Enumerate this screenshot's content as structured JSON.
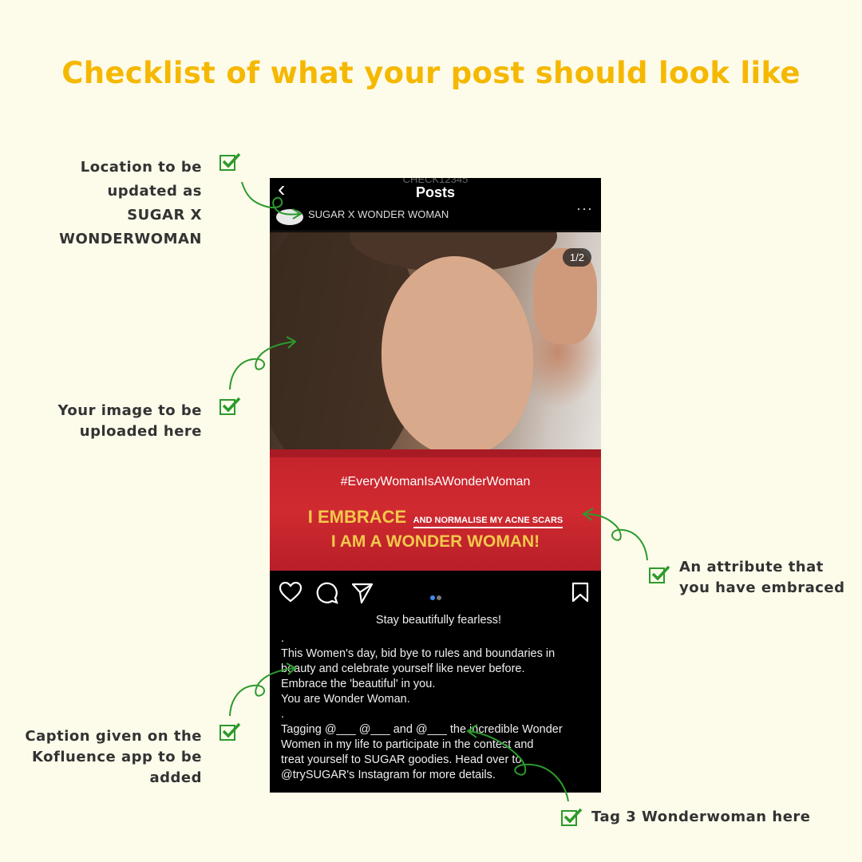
{
  "title": "Checklist of what your post should look like",
  "notes": {
    "location": [
      "Location to be",
      "updated as",
      "SUGAR X",
      "WONDERWOMAN"
    ],
    "image": [
      "Your image to be",
      "uploaded here"
    ],
    "attribute": [
      "An attribute that",
      "you have embraced"
    ],
    "caption": [
      "Caption given on the",
      "Kofluence app to be",
      "added"
    ],
    "tag": [
      "Tag 3 Wonderwoman here"
    ]
  },
  "phone": {
    "header_cut_text": "CHECK12345",
    "header_title": "Posts",
    "location_text": "SUGAR X WONDER WOMAN",
    "more_glyph": "···",
    "back_glyph": "‹",
    "slide_badge": "1/2",
    "banner": {
      "hashtag": "#EveryWomanIsAWonderWoman",
      "embrace": "I EMBRACE",
      "normalise": "AND NORMALISE MY ACNE SCARS",
      "wonder": "I AM A WONDER WOMAN!"
    },
    "icons": [
      "heart-icon",
      "comment-icon",
      "share-icon",
      "bookmark-icon"
    ],
    "caption_lines": [
      "Stay beautifully fearless!",
      ".",
      "This Women's day, bid bye to rules and boundaries in",
      "beauty and celebrate yourself like never before.",
      "Embrace the 'beautiful' in you.",
      "You are Wonder Woman.",
      ".",
      "Tagging @___ @___ and @___ the incredible Wonder",
      "Women in my life to participate in the contest and",
      "treat yourself to SUGAR goodies. Head over to",
      "@trySUGAR's Instagram for more details."
    ]
  },
  "colors": {
    "accent_yellow": "#f5b800",
    "check_green": "#2c9a2c",
    "banner_red": "#c4232c"
  }
}
